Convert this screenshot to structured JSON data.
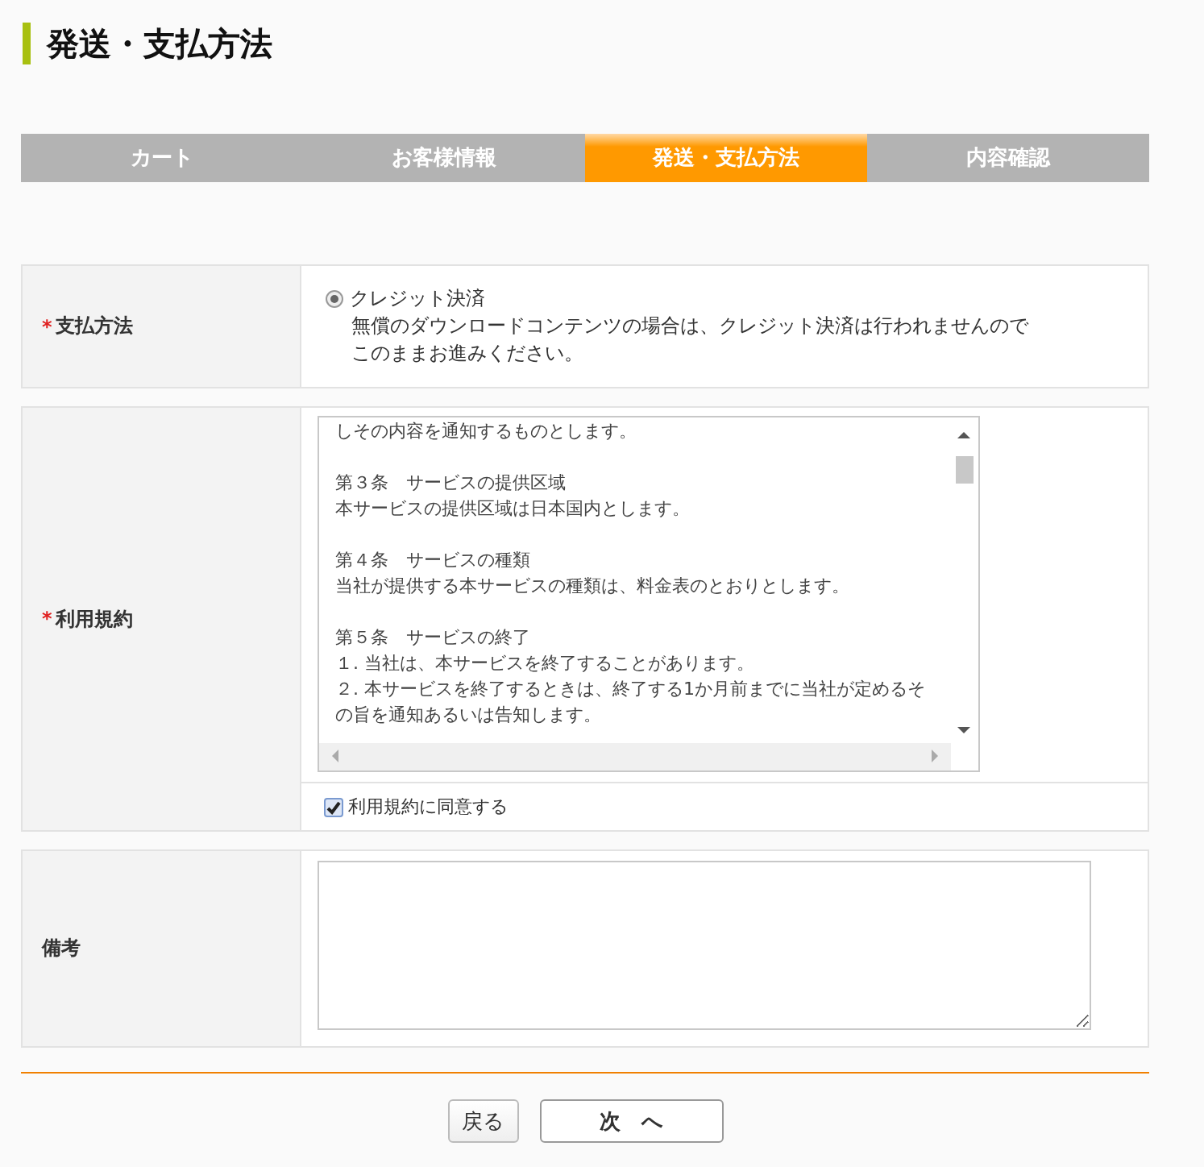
{
  "page_title": "発送・支払方法",
  "steps": [
    {
      "label": "カート",
      "selected": false
    },
    {
      "label": "お客様情報",
      "selected": false
    },
    {
      "label": "発送・支払方法",
      "selected": true
    },
    {
      "label": "内容確認",
      "selected": false
    }
  ],
  "payment": {
    "label": "支払方法",
    "required": true,
    "required_mark": "*",
    "options": [
      {
        "label": "クレジット決済",
        "selected": true
      }
    ],
    "note": [
      "無償のダウンロードコンテンツの場合は、クレジット決済は行われませんので",
      "このままお進みください。"
    ]
  },
  "terms": {
    "label": "利用規約",
    "required": true,
    "required_mark": "*",
    "paragraphs": [
      [
        "しその内容を通知するものとします。"
      ],
      [
        "第３条　サービスの提供区域",
        "本サービスの提供区域は日本国内とします。"
      ],
      [
        "第４条　サービスの種類",
        "当社が提供する本サービスの種類は、料金表のとおりとします。"
      ],
      [
        "第５条　サービスの終了",
        "１. 当社は、本サービスを終了することがあります。",
        "２. 本サービスを終了するときは、終了する1か月前までに当社が定めるその旨を通知あるいは告知します。"
      ]
    ],
    "agree": {
      "label": "利用規約に同意する",
      "checked": true
    }
  },
  "remarks": {
    "label": "備考"
  },
  "buttons": {
    "back": "戻る",
    "next": "次　へ"
  }
}
